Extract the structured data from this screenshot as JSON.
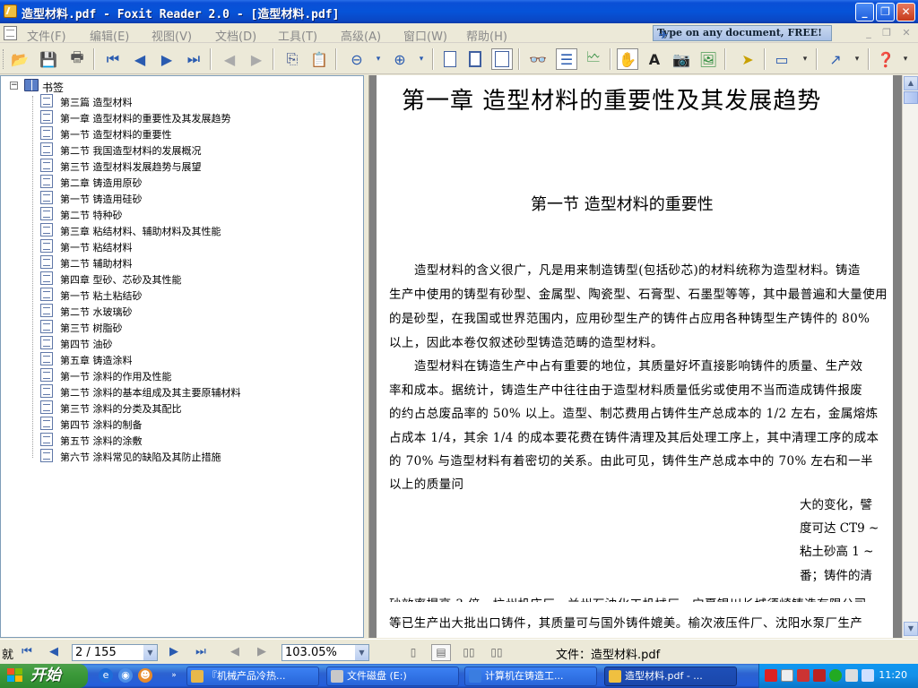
{
  "window": {
    "title": "造型材料.pdf - Foxit Reader 2.0 - [造型材料.pdf]",
    "controls": {
      "minimize": "_",
      "restore": "❐",
      "close": "✕"
    }
  },
  "menu": [
    {
      "label": "文件(F)"
    },
    {
      "label": "编辑(E)"
    },
    {
      "label": "视图(V)"
    },
    {
      "label": "文档(D)"
    },
    {
      "label": "工具(T)"
    },
    {
      "label": "高级(A)"
    },
    {
      "label": "窗口(W)"
    },
    {
      "label": "帮助(H)"
    }
  ],
  "ad_banner": "Type on any document, FREE!",
  "bookmarks": {
    "root": "书签",
    "items": [
      "第三篇  造型材料",
      "第一章  造型材料的重要性及其发展趋势",
      "第一节  造型材料的重要性",
      "第二节  我国造型材料的发展概况",
      "第三节  造型材料发展趋势与展望",
      "第二章  铸造用原砂",
      "第一节  铸造用硅砂",
      "第二节  特种砂",
      "第三章  粘结材料、辅助材料及其性能",
      "第一节  粘结材料",
      "第二节  辅助材料",
      "第四章  型砂、芯砂及其性能",
      "第一节  粘土粘结砂",
      "第二节  水玻璃砂",
      "第三节  树脂砂",
      "第四节  油砂",
      "第五章  铸造涂料",
      "第一节  涂料的作用及性能",
      "第二节  涂料的基本组成及其主要原辅材料",
      "第三节  涂料的分类及其配比",
      "第四节  涂料的制备",
      "第五节  涂料的涂敷",
      "第六节  涂料常见的缺陷及其防止措施"
    ]
  },
  "document": {
    "chapter_title": "第一章   造型材料的重要性及其发展趋势",
    "section_title": "第一节   造型材料的重要性",
    "lines": [
      "造型材料的含义很广，凡是用来制造铸型(包括砂芯)的材料统称为造型材料。铸造",
      "生产中使用的铸型有砂型、金属型、陶瓷型、石膏型、石墨型等等，其中最普遍和大量使用",
      "的是砂型，在我国或世界范围内，应用砂型生产的铸件占应用各种铸型生产铸件的 80%",
      "以上，因此本卷仅叙述砂型铸造范畴的造型材料。",
      "造型材料在铸造生产中占有重要的地位，其质量好坏直接影响铸件的质量、生产效",
      "率和成本。据统计，铸造生产中往往由于造型材料质量低劣或使用不当而造成铸件报废",
      "的约占总废品率的 50% 以上。造型、制芯费用占铸件生产总成本的 1/2 左右，金属熔炼",
      "占成本 1/4，其余 1/4 的成本要花费在铸件清理及其后处理工序上，其中清理工序的成本",
      "的 70% 与造型材料有着密切的关系。由此可见，铸件生产总成本中的 70% 左右和一半",
      "以上的质量问"
    ],
    "fragments": [
      "大的变化，譬",
      "度可达 CT9 ~",
      "粘土砂高 1 ~",
      "番；铸件的清"
    ],
    "partial_line": "砂效率提高 3 倍。杭州机床厂、兰州石油化工机械厂、宁夏银川长城须崎铸造有限公司",
    "last_line": "等已生产出大批出口铸件，其质量可与国外铸件媲美。榆次液压件厂、沈阳水泵厂生产"
  },
  "status": {
    "ready": "就",
    "page_input": "2 / 155",
    "zoom": "103.05%",
    "file_label": "文件：造型材料.pdf"
  },
  "taskbar": {
    "start": "开始",
    "tasks": [
      {
        "label": "『机械产品冷热...",
        "color": "#e7b84a"
      },
      {
        "label": "文件磁盘 (E:)",
        "color": "#c8c8c8"
      },
      {
        "label": "计算机在铸造工...",
        "color": "#3a7de0"
      },
      {
        "label": "造型材料.pdf - ...",
        "color": "#f0c040"
      }
    ],
    "clock": "11:20"
  }
}
